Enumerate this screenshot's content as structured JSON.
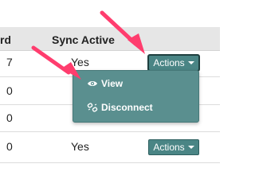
{
  "table": {
    "columns": {
      "records_fragment": "rds",
      "sync_active": "Sync Active"
    },
    "rows": [
      {
        "records": "7",
        "sync": "Yes",
        "action": "Actions"
      },
      {
        "records": "0",
        "sync": "",
        "action": ""
      },
      {
        "records": "0",
        "sync": "",
        "action": ""
      },
      {
        "records": "0",
        "sync": "Yes",
        "action": "Actions"
      }
    ]
  },
  "dropdown": {
    "items": [
      {
        "label": "View",
        "icon": "eye-icon"
      },
      {
        "label": "Disconnect",
        "icon": "unlink-icon"
      }
    ]
  },
  "colors": {
    "button": "#4a8585",
    "menu": "#5a8f8f",
    "arrow": "#ff3d6e"
  }
}
